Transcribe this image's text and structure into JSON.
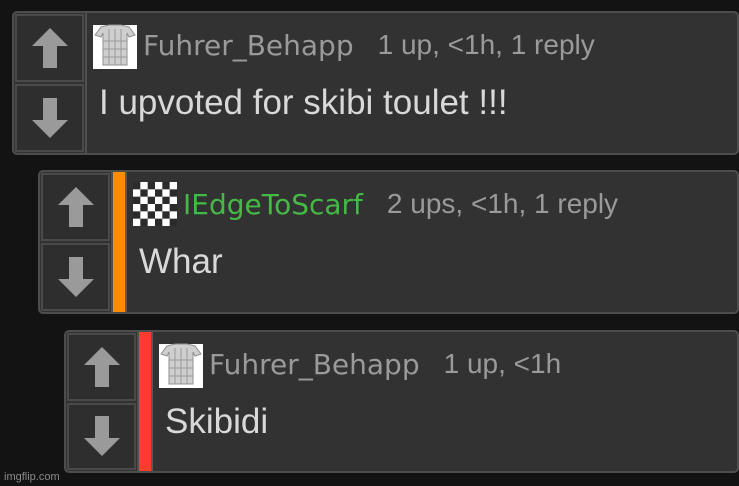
{
  "comments": [
    {
      "username": "Fuhrer_Behapp",
      "meta": "1 up, <1h, 1 reply",
      "text": "I upvoted for skibi toulet !!!",
      "avatar_icon": "shirt-avatar-icon",
      "username_color": "#9a9a9a",
      "indent_bar_color": null
    },
    {
      "username": "IEdgeToScarf",
      "meta": "2 ups, <1h, 1 reply",
      "text": "Whar",
      "avatar_icon": "checkered-avatar-icon",
      "username_color": "#46b846",
      "indent_bar_color": "#ff8c00"
    },
    {
      "username": "Fuhrer_Behapp",
      "meta": "1 up, <1h",
      "text": "Skibidi",
      "avatar_icon": "shirt-avatar-icon",
      "username_color": "#9a9a9a",
      "indent_bar_color": "#ff3b30"
    }
  ],
  "icons": {
    "upvote": "arrow-up-icon",
    "downvote": "arrow-down-icon"
  },
  "watermark": "imgflip.com"
}
